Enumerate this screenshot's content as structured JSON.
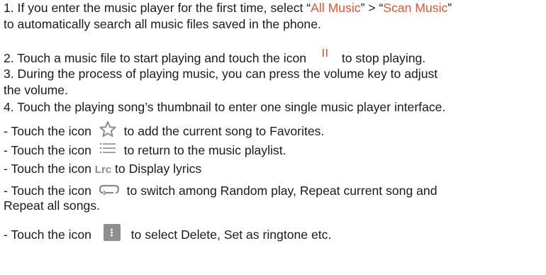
{
  "lines": {
    "l1a_prefix": "1. If you enter the music player for the first time, select “",
    "l1a_all_music": "All Music",
    "l1a_mid": "” > “",
    "l1a_scan_music": "Scan Music",
    "l1a_suffix": "”",
    "l1b": "to automatically search all music files saved in the phone.",
    "l2_prefix": "2. Touch a music file to start playing and touch the icon",
    "l2_suffix": "to stop playing.",
    "l3a": "3. During the process of playing music, you can press the volume key to adjust",
    "l3b": "the volume.",
    "l4": "4. Touch the playing song’s thumbnail to enter one single music player interface.",
    "b1_prefix": "- Touch the icon",
    "b1_suffix": "to add the current song to Favorites.",
    "b2_prefix": "- Touch the icon",
    "b2_suffix": "to return to the music playlist.",
    "b3_prefix": "- Touch the icon",
    "b3_lrc": "Lrc",
    "b3_suffix": "to Display lyrics",
    "b4_prefix": "- Touch the icon",
    "b4_suffix": "to switch among Random play, Repeat current song and",
    "b4b": "Repeat all songs.",
    "b5_prefix": "- Touch the icon",
    "b5_suffix": "to select Delete, Set as ringtone etc."
  },
  "icons": {
    "pause": "pause-icon",
    "star": "star-icon",
    "list": "list-icon",
    "repeat": "repeat-icon",
    "menu": "more-menu-icon"
  },
  "colors": {
    "accent": "#e8522e",
    "icon_gray": "#8c8c8c"
  }
}
